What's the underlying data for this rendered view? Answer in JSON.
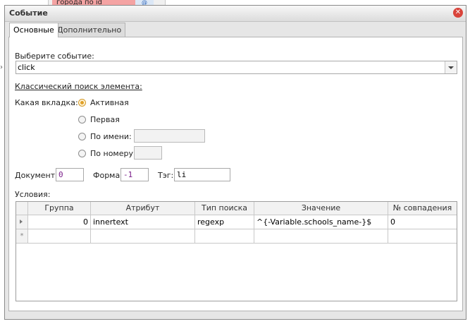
{
  "background": {
    "node_label": "города по id",
    "node_icon": "@",
    "side_mark": "›"
  },
  "dialog": {
    "title": "Событие",
    "close_icon": "close-icon",
    "tabs": [
      {
        "label": "Основные",
        "active": true
      },
      {
        "label": "Дополнительно",
        "active": false
      }
    ],
    "event_label": "Выберите событие:",
    "event_value": "click",
    "classic_search_label": "Классический поиск элемента:",
    "which_tab_label": "Какая вкладка:",
    "tab_options": [
      {
        "label": "Активная",
        "selected": true
      },
      {
        "label": "Первая",
        "selected": false
      },
      {
        "label": "По имени:",
        "selected": false
      },
      {
        "label": "По номеру:",
        "selected": false
      }
    ],
    "by_name_value": "",
    "by_number_value": "",
    "document_label": "Документ:",
    "document_value": "0",
    "form_label": "Форма:",
    "form_value": "-1",
    "tag_label": "Тэг:",
    "tag_value": "li",
    "conditions_label": "Условия:",
    "accent_color": "#e0a028",
    "close_color": "#d9443b"
  },
  "conditions_table": {
    "columns": [
      "Группа",
      "Атрибут",
      "Тип поиска",
      "Значение",
      "№ совпадения"
    ],
    "rows": [
      [
        "0",
        "innertext",
        "regexp",
        "^{-Variable.schools_name-}$",
        "0"
      ]
    ],
    "new_row_marker": "*"
  }
}
